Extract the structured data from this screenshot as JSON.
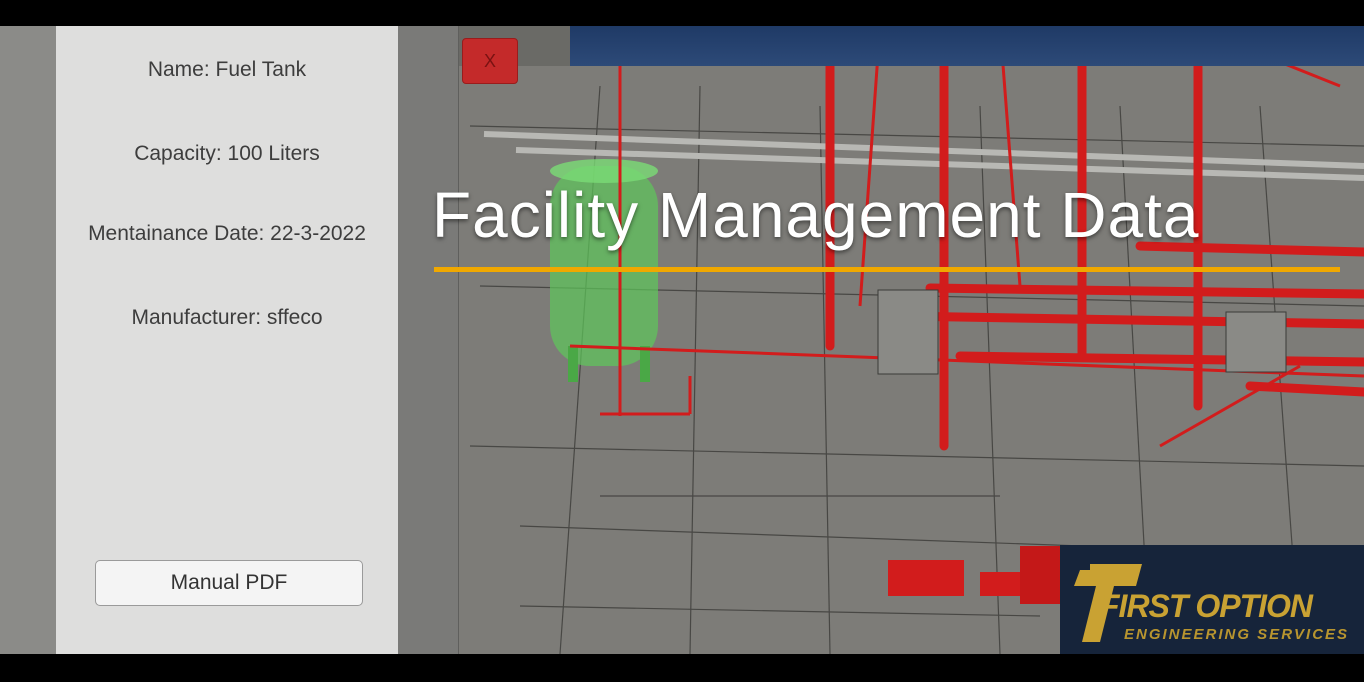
{
  "info_panel": {
    "name": "Name: Fuel Tank",
    "capacity": "Capacity: 100 Liters",
    "maintenance_date": "Mentainance Date: 22-3-2022",
    "manufacturer": "Manufacturer: sffeco",
    "manual_button": "Manual PDF"
  },
  "close_button": "X",
  "headline": "Facility Management Data",
  "logo": {
    "main": "FIRST OPTION",
    "sub": "ENGINEERING SERVICES"
  },
  "colors": {
    "accent_underline": "#f0a800",
    "pipe_red": "#d21c1c",
    "tank_green": "#5ec85a",
    "logo_navy": "#16243a",
    "logo_gold": "#c9a233"
  }
}
